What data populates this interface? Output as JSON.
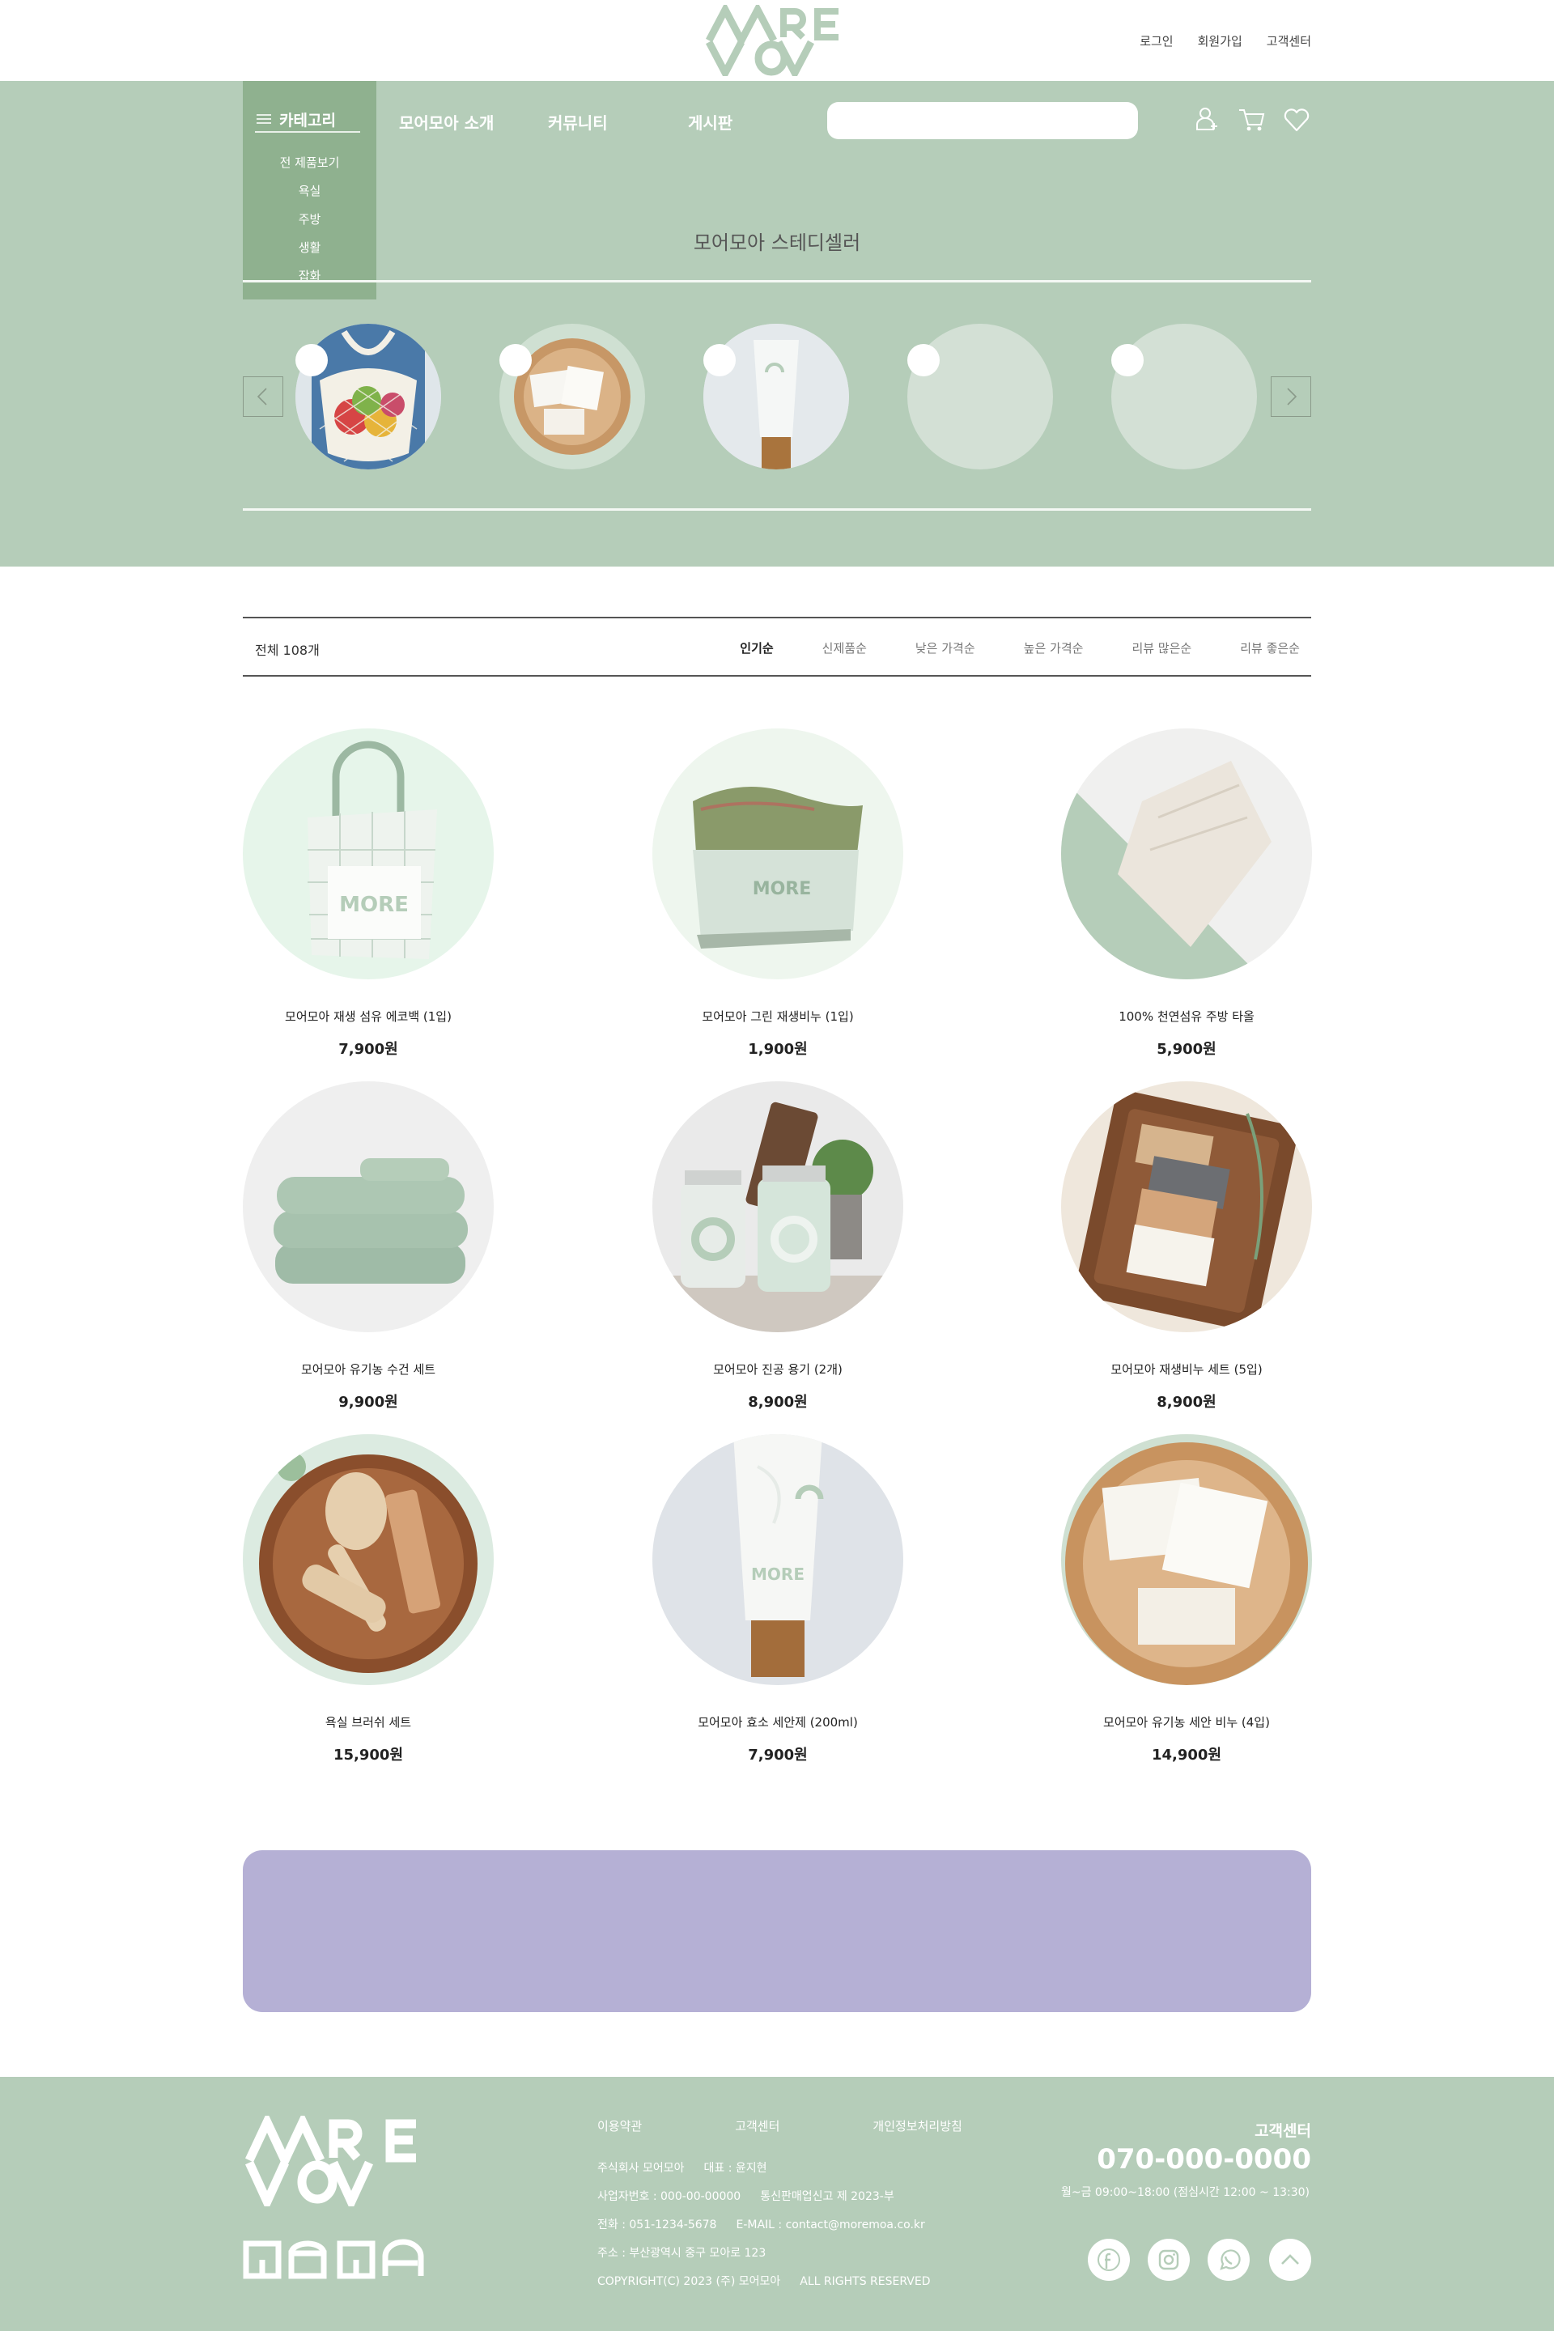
{
  "brand": {
    "logo_text": "MORE MOA"
  },
  "util_links": [
    "로그인",
    "회원가입",
    "고객센터"
  ],
  "nav": {
    "category_label": "카테고리",
    "categories": [
      "전 제품보기",
      "욕실",
      "주방",
      "생활",
      "잡화"
    ],
    "items": [
      "모어모아 소개",
      "커뮤니티",
      "게시판"
    ],
    "search_placeholder": "",
    "icons": [
      "user-icon",
      "cart-icon",
      "heart-icon"
    ]
  },
  "hero": {
    "title": "모어모아 스테디셀러"
  },
  "sort": {
    "total": "전체 108개",
    "options": [
      "인기순",
      "신제품순",
      "낮은 가격순",
      "높은 가격순",
      "리뷰 많은순",
      "리뷰 좋은순"
    ],
    "active": "인기순"
  },
  "products": [
    {
      "name": "모어모아 재생 섬유 에코백 (1입)",
      "price": "7,900원"
    },
    {
      "name": "모어모아 그린 재생비누 (1입)",
      "price": "1,900원"
    },
    {
      "name": "100% 천연섬유 주방 타올",
      "price": "5,900원"
    },
    {
      "name": "모어모아 유기농 수건 세트",
      "price": "9,900원"
    },
    {
      "name": "모어모아 진공 용기 (2개)",
      "price": "8,900원"
    },
    {
      "name": "모어모아 재생비누 세트 (5입)",
      "price": "8,900원"
    },
    {
      "name": "욕실 브러쉬 세트",
      "price": "15,900원"
    },
    {
      "name": "모어모아 효소 세안제 (200ml)",
      "price": "7,900원"
    },
    {
      "name": "모어모아 유기농 세안 비누 (4입)",
      "price": "14,900원"
    }
  ],
  "footer": {
    "links": [
      "이용약관",
      "고객센터",
      "개인정보처리방침"
    ],
    "company": "주식회사 모어모아",
    "ceo": "대표 : 윤지현",
    "biz_no": "사업자번호 : 000-00-00000",
    "mail_order": "통신판매업신고 제 2023-부",
    "tel": "전화 : 051-1234-5678",
    "email": "E-MAIL : contact@moremoa.co.kr",
    "address": "주소 : 부산광역시 중구 모아로 123",
    "copyright": "COPYRIGHT(C) 2023 (주) 모어모아",
    "rights": "ALL RIGHTS RESERVED",
    "cs_title": "고객센터",
    "cs_phone": "070-000-0000",
    "cs_hours": "월~금 09:00~18:00 (점심시간 12:00 ~ 13:30)",
    "social_icons": [
      "facebook-icon",
      "instagram-icon",
      "whatsapp-icon",
      "scroll-top-icon"
    ]
  },
  "colors": {
    "sage": "#b5cdb9",
    "sage_dark": "#8fb18f",
    "banner": "#b5b0d5"
  }
}
